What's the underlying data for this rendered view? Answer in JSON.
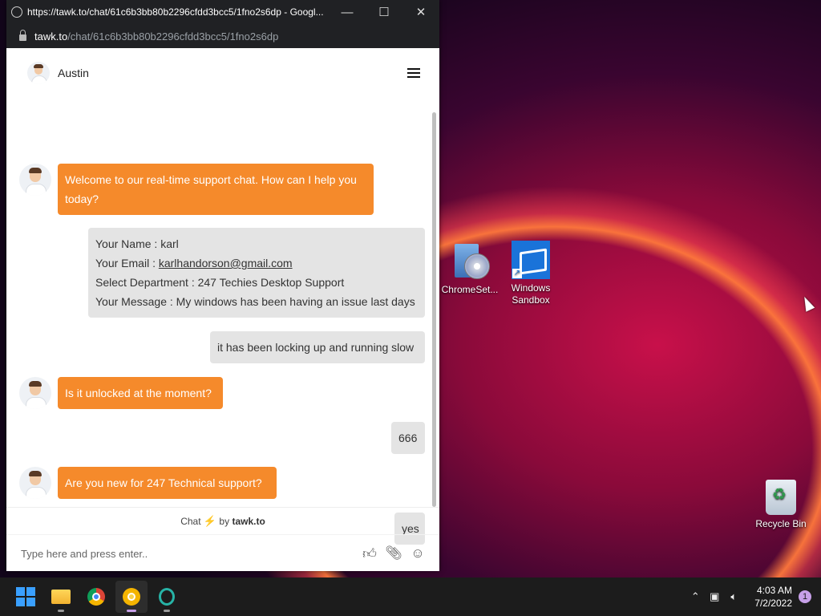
{
  "browser": {
    "title": "https://tawk.to/chat/61c6b3bb80b2296cfdd3bcc5/1fno2s6dp - Googl...",
    "url_host": "tawk.to",
    "url_path": "/chat/61c6b3bb80b2296cfdd3bcc5/1fno2s6dp",
    "minimize": "—",
    "maximize": "☐",
    "close": "✕"
  },
  "chat": {
    "agent_name": "Austin",
    "messages": [
      {
        "from": "agent",
        "text": "Welcome to our real-time support chat. How can I help you today?"
      },
      {
        "from": "visitor",
        "name_line": "Your Name : karl",
        "email_label": "Your Email : ",
        "email": "karlhandorson@gmail.com",
        "department_line": "Select Department : 247 Techies Desktop Support",
        "message_line": "Your Message : My windows has been having an issue last days"
      },
      {
        "from": "visitor",
        "text": "it has been locking up and running slow"
      },
      {
        "from": "agent",
        "text": "Is it unlocked at the moment?"
      },
      {
        "from": "visitor",
        "text": "666"
      },
      {
        "from": "agent",
        "text": "Are you new for 247 Technical support?"
      },
      {
        "from": "visitor",
        "text": "yes"
      }
    ],
    "powered_prefix": "Chat",
    "powered_by": "by",
    "powered_brand": "tawk.to",
    "input_placeholder": "Type here and press enter..",
    "icons": [
      "thumbs-up-icon",
      "paperclip-icon",
      "emoji-icon"
    ]
  },
  "desktop": {
    "icons": [
      {
        "label": "ChromeSet..."
      },
      {
        "label": "Windows Sandbox"
      },
      {
        "label": "Recycle Bin"
      }
    ]
  },
  "taskbar": {
    "apps": [
      "start",
      "file-explorer",
      "chrome",
      "chrome-canary",
      "opera"
    ],
    "time": "4:03 AM",
    "date": "7/2/2022",
    "notification_count": "1"
  },
  "colors": {
    "agent_bubble": "#f58a2b",
    "visitor_bubble": "#e4e4e4",
    "titlebar": "#202124",
    "taskbar": "#1c1c1c"
  }
}
